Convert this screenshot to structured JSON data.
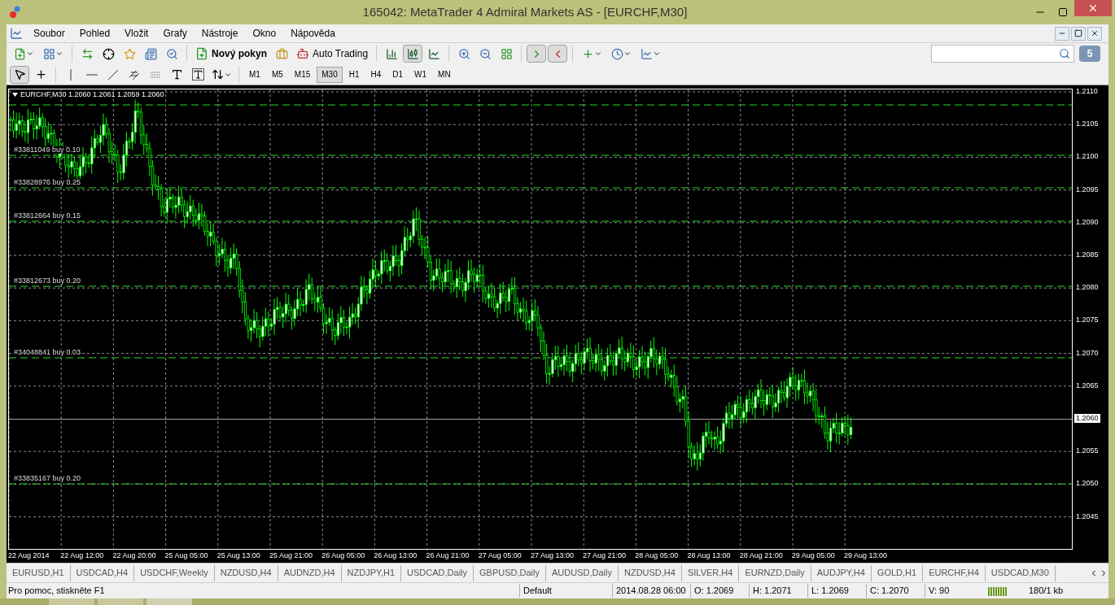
{
  "window": {
    "title": "165042: MetaTrader 4 Admiral Markets AS - [EURCHF,M30]"
  },
  "menu": [
    "Soubor",
    "Pohled",
    "Vložit",
    "Grafy",
    "Nástroje",
    "Okno",
    "Nápověda"
  ],
  "toolbar": {
    "new_order": "Nový pokyn",
    "auto_trading": "Auto Trading",
    "chart_types": [
      {
        "selected": false
      },
      {
        "selected": true
      },
      {
        "selected": false
      }
    ],
    "auto_scroll": {
      "selected": true
    },
    "chart_shift": {
      "selected": true
    },
    "notifications": "5"
  },
  "drawing_tools": [
    {
      "kind": "cursor",
      "selected": true
    },
    {
      "kind": "crosshair",
      "selected": false
    }
  ],
  "timeframes": [
    {
      "label": "M1",
      "selected": false
    },
    {
      "label": "M5",
      "selected": false
    },
    {
      "label": "M15",
      "selected": false
    },
    {
      "label": "M30",
      "selected": true
    },
    {
      "label": "H1",
      "selected": false
    },
    {
      "label": "H4",
      "selected": false
    },
    {
      "label": "D1",
      "selected": false
    },
    {
      "label": "W1",
      "selected": false
    },
    {
      "label": "MN",
      "selected": false
    }
  ],
  "chart": {
    "header": "EURCHF,M30  1.2060 1.2061 1.2059 1.2060",
    "orders": [
      "#33811049 buy 0.10",
      "#33828976 buy 0.25",
      "#33812664 buy 0.15",
      "#33812673 buy 0.20",
      "#34048841 buy 0.03",
      "#33835167 buy 0.20"
    ],
    "price_labels": [
      {
        "label": "1.2110",
        "current": false
      },
      {
        "label": "1.2105",
        "current": false
      },
      {
        "label": "1.2100",
        "current": false
      },
      {
        "label": "1.2095",
        "current": false
      },
      {
        "label": "1.2090",
        "current": false
      },
      {
        "label": "1.2085",
        "current": false
      },
      {
        "label": "1.2080",
        "current": false
      },
      {
        "label": "1.2075",
        "current": false
      },
      {
        "label": "1.2070",
        "current": false
      },
      {
        "label": "1.2065",
        "current": false
      },
      {
        "label": "1.2060",
        "current": true
      },
      {
        "label": "1.2055",
        "current": false
      },
      {
        "label": "1.2050",
        "current": false
      },
      {
        "label": "1.2045",
        "current": false
      }
    ],
    "time_labels": [
      "22 Aug 2014",
      "22 Aug 12:00",
      "22 Aug 20:00",
      "25 Aug 05:00",
      "25 Aug 13:00",
      "25 Aug 21:00",
      "26 Aug 05:00",
      "26 Aug 13:00",
      "26 Aug 21:00",
      "27 Aug 05:00",
      "27 Aug 13:00",
      "27 Aug 21:00",
      "28 Aug 05:00",
      "28 Aug 13:00",
      "28 Aug 21:00",
      "29 Aug 05:00",
      "29 Aug 13:00"
    ]
  },
  "chart_tabs": [
    "EURUSD,H1",
    "USDCAD,H4",
    "USDCHF,Weekly",
    "NZDUSD,H4",
    "AUDNZD,H4",
    "NZDJPY,H1",
    "USDCAD,Daily",
    "GBPUSD,Daily",
    "AUDUSD,Daily",
    "NZDUSD,H4",
    "SILVER,H4",
    "EURNZD,Daily",
    "AUDJPY,H4",
    "GOLD,H1",
    "EURCHF,H4",
    "USDCAD,M30"
  ],
  "status_bar": {
    "help": "Pro pomoc, stiskněte F1",
    "profile": "Default",
    "time": "2014.08.28 06:00",
    "open": "O: 1.2069",
    "high": "H: 1.2071",
    "low": "L: 1.2069",
    "close": "C: 1.2070",
    "volume": "V: 90",
    "traffic": "180/1 kb"
  }
}
